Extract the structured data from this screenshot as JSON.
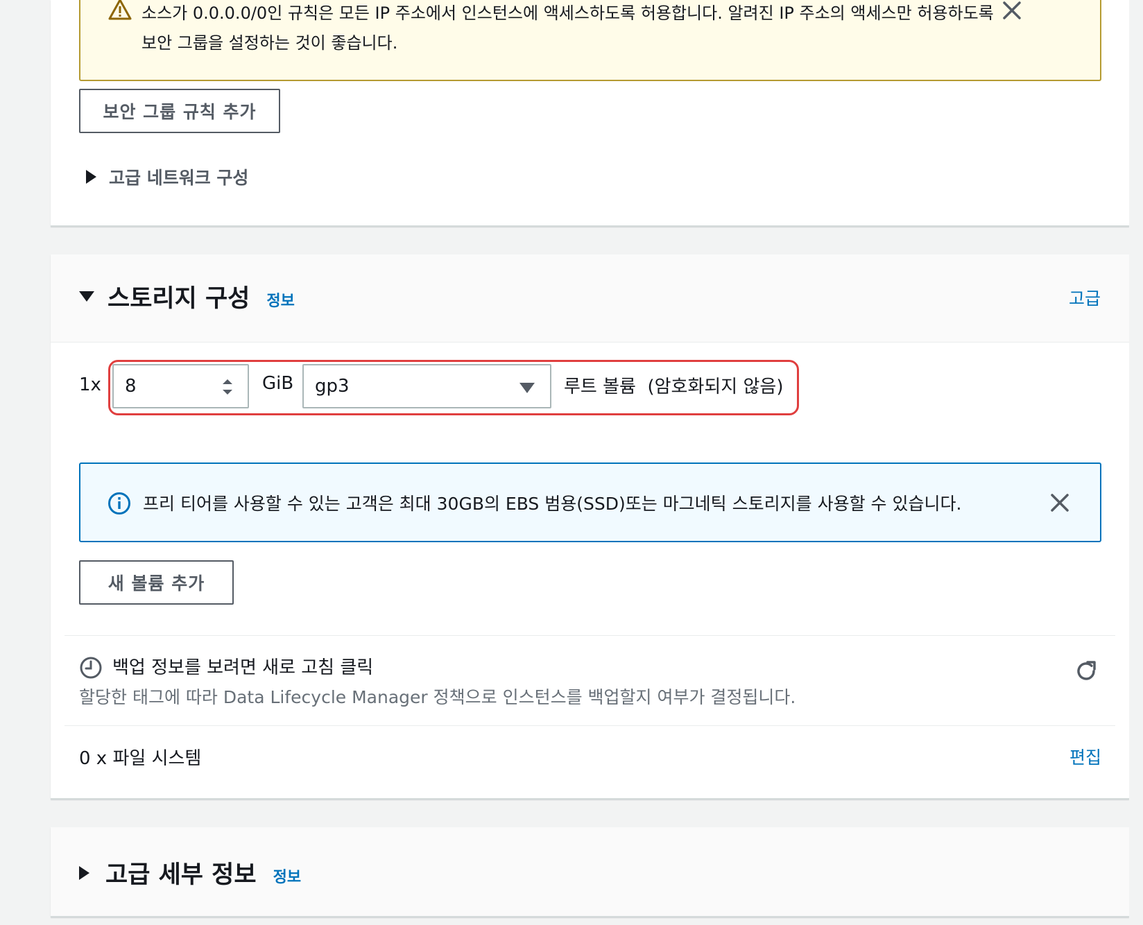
{
  "network_section": {
    "warning": {
      "text": "소스가 0.0.0.0/0인 규칙은 모든 IP 주소에서 인스턴스에 액세스하도록 허용합니다. 알려진 IP 주소의 액세스만 허용하도록 보안 그룹을 설정하는 것이 좋습니다.",
      "icon": "warning-icon",
      "close_icon": "close-icon"
    },
    "add_rule_button": "보안 그룹 규칙 추가",
    "advanced_network_expander": "고급 네트워크 구성"
  },
  "storage_section": {
    "title": "스토리지 구성",
    "info_link": "정보",
    "advanced_link": "고급",
    "volume": {
      "count": "1x",
      "size": "8",
      "unit": "GiB",
      "type": "gp3",
      "description": "루트 볼륨  (암호화되지 않음)"
    },
    "free_tier_alert": {
      "text": "프리 티어를 사용할 수 있는 고객은 최대 30GB의 EBS 범용(SSD)또는 마그네틱 스토리지를 사용할 수 있습니다.",
      "icon": "info-icon",
      "close_icon": "close-icon"
    },
    "add_volume_button": "새 볼륨 추가",
    "backup": {
      "title": "백업 정보를 보려면 새로 고침 클릭",
      "description": "할당한 태그에 따라 Data Lifecycle Manager 정책으로 인스턴스를 백업할지 여부가 결정됩니다.",
      "icon": "clock-icon",
      "refresh_icon": "refresh-icon"
    },
    "file_systems": {
      "label": "0 x 파일 시스템",
      "edit_link": "편집"
    }
  },
  "advanced_section": {
    "title": "고급 세부 정보",
    "info_link": "정보"
  },
  "colors": {
    "link": "#0073bb",
    "warning_border": "#b59b32",
    "warning_bg": "#fffce9",
    "info_border": "#0073bb",
    "info_bg": "#f1faff",
    "highlight": "#e03f3f"
  }
}
